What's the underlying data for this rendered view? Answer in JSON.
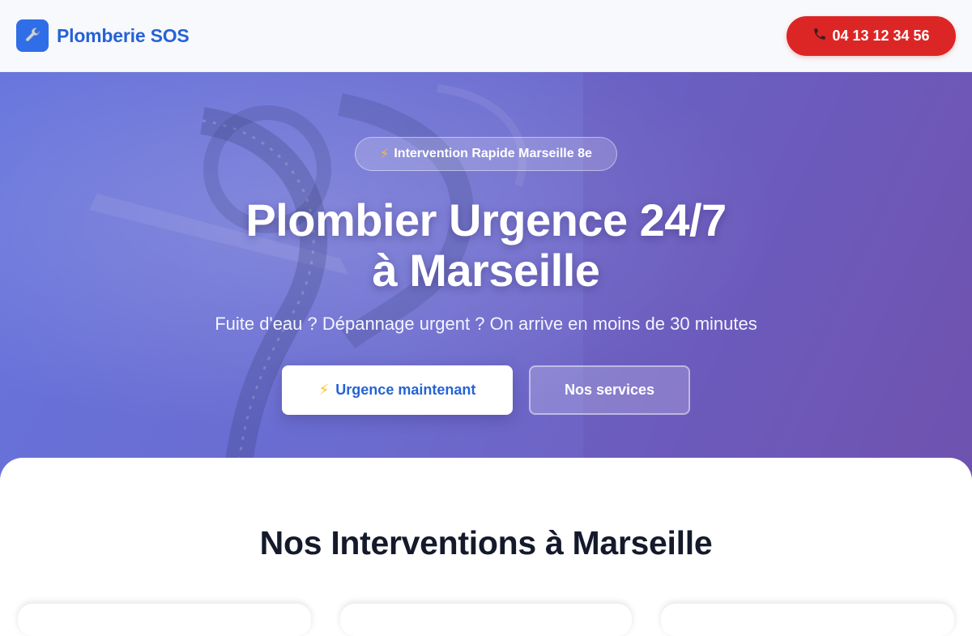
{
  "header": {
    "brand_icon": "wrench-icon",
    "brand_name": "Plomberie SOS",
    "phone_icon": "phone-icon",
    "phone_number": "04 13 12 34 56"
  },
  "hero": {
    "badge": "Intervention Rapide Marseille 8e",
    "title_line1": "Plombier Urgence 24/7",
    "title_line2": "à Marseille",
    "subtitle": "Fuite d'eau ? Dépannage urgent ? On arrive en moins de 30 minutes",
    "primary_button": "Urgence maintenant",
    "secondary_button": "Nos services"
  },
  "section": {
    "title": "Nos Interventions à Marseille"
  },
  "colors": {
    "brand_blue": "#2563d6",
    "emergency_red": "#dc2626",
    "hero_gradient_start": "#6674dc",
    "hero_gradient_end": "#7356b2",
    "bolt_yellow": "#fbbf24",
    "heading_dark": "#141a2b"
  }
}
